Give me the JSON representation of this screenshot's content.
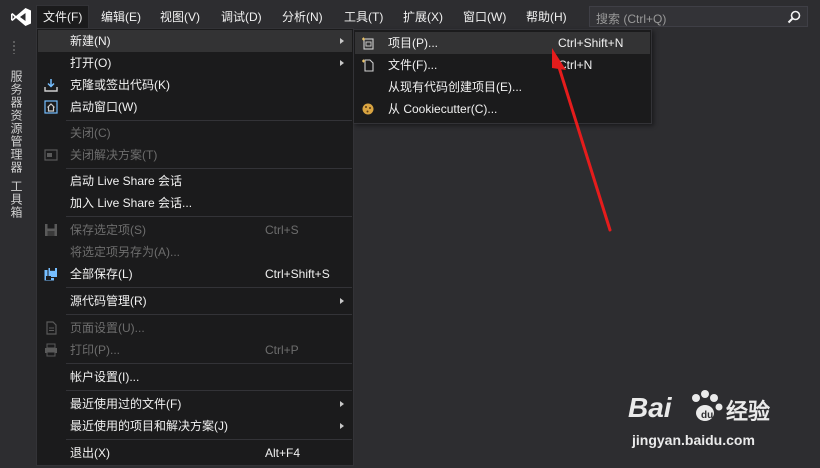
{
  "menubar": {
    "items": [
      {
        "label": "文件(F)"
      },
      {
        "label": "编辑(E)"
      },
      {
        "label": "视图(V)"
      },
      {
        "label": "调试(D)"
      },
      {
        "label": "分析(N)"
      },
      {
        "label": "工具(T)"
      },
      {
        "label": "扩展(X)"
      },
      {
        "label": "窗口(W)"
      },
      {
        "label": "帮助(H)"
      }
    ],
    "search_placeholder": "搜索 (Ctrl+Q)"
  },
  "side_tabs": [
    "服务器资源管理器",
    "工具箱"
  ],
  "file_menu": {
    "items": [
      {
        "label": "新建(N)",
        "shortcut": "",
        "submenu": true,
        "disabled": false,
        "icon": ""
      },
      {
        "label": "打开(O)",
        "shortcut": "",
        "submenu": true,
        "disabled": false,
        "icon": ""
      },
      {
        "label": "克隆或签出代码(K)",
        "shortcut": "",
        "submenu": false,
        "disabled": false,
        "icon": "download-icon"
      },
      {
        "label": "启动窗口(W)",
        "shortcut": "",
        "submenu": false,
        "disabled": false,
        "icon": "home-icon"
      },
      {
        "label": "关闭(C)",
        "shortcut": "",
        "submenu": false,
        "disabled": true,
        "icon": ""
      },
      {
        "label": "关闭解决方案(T)",
        "shortcut": "",
        "submenu": false,
        "disabled": true,
        "icon": "close-solution-icon"
      },
      {
        "label": "启动 Live Share 会话",
        "shortcut": "",
        "submenu": false,
        "disabled": false,
        "icon": ""
      },
      {
        "label": "加入 Live Share 会话...",
        "shortcut": "",
        "submenu": false,
        "disabled": false,
        "icon": ""
      },
      {
        "label": "保存选定项(S)",
        "shortcut": "Ctrl+S",
        "submenu": false,
        "disabled": true,
        "icon": "save-icon"
      },
      {
        "label": "将选定项另存为(A)...",
        "shortcut": "",
        "submenu": false,
        "disabled": true,
        "icon": ""
      },
      {
        "label": "全部保存(L)",
        "shortcut": "Ctrl+Shift+S",
        "submenu": false,
        "disabled": false,
        "icon": "save-all-icon"
      },
      {
        "label": "源代码管理(R)",
        "shortcut": "",
        "submenu": true,
        "disabled": false,
        "icon": ""
      },
      {
        "label": "页面设置(U)...",
        "shortcut": "",
        "submenu": false,
        "disabled": true,
        "icon": "page-setup-icon"
      },
      {
        "label": "打印(P)...",
        "shortcut": "Ctrl+P",
        "submenu": false,
        "disabled": true,
        "icon": "print-icon"
      },
      {
        "label": "帐户设置(I)...",
        "shortcut": "",
        "submenu": false,
        "disabled": false,
        "icon": ""
      },
      {
        "label": "最近使用过的文件(F)",
        "shortcut": "",
        "submenu": true,
        "disabled": false,
        "icon": ""
      },
      {
        "label": "最近使用的项目和解决方案(J)",
        "shortcut": "",
        "submenu": true,
        "disabled": false,
        "icon": ""
      },
      {
        "label": "退出(X)",
        "shortcut": "Alt+F4",
        "submenu": false,
        "disabled": false,
        "icon": ""
      }
    ]
  },
  "new_submenu": {
    "items": [
      {
        "label": "项目(P)...",
        "shortcut": "Ctrl+Shift+N",
        "icon": "new-project-icon"
      },
      {
        "label": "文件(F)...",
        "shortcut": "Ctrl+N",
        "icon": "new-file-icon"
      },
      {
        "label": "从现有代码创建项目(E)...",
        "shortcut": "",
        "icon": ""
      },
      {
        "label": "从 Cookiecutter(C)...",
        "shortcut": "",
        "icon": "cookiecutter-icon"
      }
    ]
  },
  "watermark": {
    "brand": "Bai",
    "cn": "经验",
    "url": "jingyan.baidu.com"
  },
  "colors": {
    "menu_bg": "#1b1b1c",
    "highlight": "#333334",
    "annotation_arrow": "#e51c1c",
    "vs_purple": "#865fc5"
  }
}
